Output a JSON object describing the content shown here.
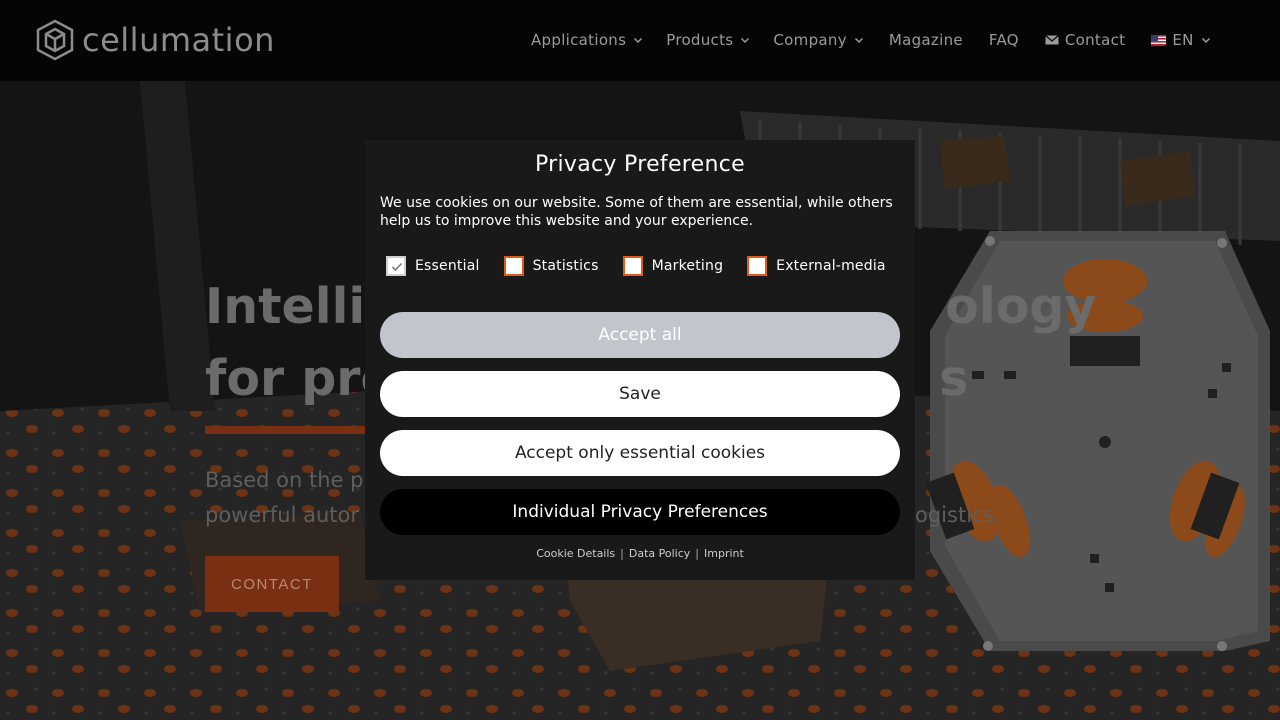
{
  "header": {
    "brand": "cellumation",
    "nav": [
      {
        "label": "Applications",
        "has_dropdown": true
      },
      {
        "label": "Products",
        "has_dropdown": true
      },
      {
        "label": "Company",
        "has_dropdown": true
      },
      {
        "label": "Magazine",
        "has_dropdown": false
      },
      {
        "label": "FAQ",
        "has_dropdown": false
      }
    ],
    "contact_label": "Contact",
    "contact_icon": "mail-icon",
    "language_label": "EN",
    "language_icon": "us-flag-icon"
  },
  "hero": {
    "title_line1_start": "Intellig",
    "title_line1_end": "ology",
    "title_line2_start": "for pro",
    "title_line2_end": "s",
    "subtitle_line1": "Based on the p",
    "subtitle_line2": "powerful autor",
    "subtitle_line2_end": "ogistics.",
    "cta_label": "CONTACT"
  },
  "privacy_modal": {
    "title": "Privacy Preference",
    "text": "We use cookies on our website. Some of them are essential, while others help us to improve this website and your experience.",
    "consents": [
      {
        "label": "Essential",
        "checked": true
      },
      {
        "label": "Statistics",
        "checked": false
      },
      {
        "label": "Marketing",
        "checked": false
      },
      {
        "label": "External-media",
        "checked": false
      }
    ],
    "buttons": {
      "accept_all": "Accept all",
      "save": "Save",
      "accept_essential": "Accept only essential cookies",
      "individual": "Individual Privacy Preferences"
    },
    "links": {
      "cookie_details": "Cookie Details",
      "data_policy": "Data Policy",
      "imprint": "Imprint",
      "separator": "|"
    }
  },
  "colors": {
    "accent": "#e05a1e",
    "header_bg": "#050505",
    "modal_bg": "#191919",
    "accept_all_bg": "#c2c5cc"
  }
}
